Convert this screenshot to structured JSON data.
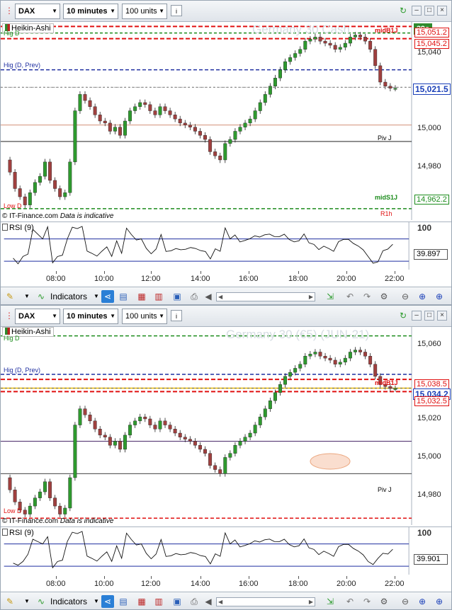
{
  "toolbar": {
    "instrument": "DAX",
    "interval": "10 minutes",
    "quantity": "100 units",
    "indicators_label": "Indicators"
  },
  "chart_top": {
    "watermark": "Germany 30 Cash",
    "indicator_tag": "Heikin-Ashi",
    "countdown": "39s",
    "copyright": "© IT-Finance.com",
    "copyright_note": "Data is indicative",
    "price_labels": [
      {
        "text": "15,051.2",
        "kind": "red"
      },
      {
        "text": "15,045.2",
        "kind": "red"
      },
      {
        "text": "15,040",
        "kind": "tick"
      },
      {
        "text": "15,021.5",
        "kind": "current"
      },
      {
        "text": "15,000",
        "kind": "tick"
      },
      {
        "text": "14,980",
        "kind": "tick"
      },
      {
        "text": "14,962.2",
        "kind": "green"
      }
    ],
    "level_labels": [
      "Hig D",
      "Hig (D, Prev)",
      "midB1J",
      "Piv J",
      "midS1J",
      "R1h",
      "Low D"
    ],
    "rsi_label": "RSI (9)",
    "rsi_value": "39.897",
    "rsi_scale": "100"
  },
  "chart_bottom": {
    "watermark": "Germany 30 (€5) (JUN-21)",
    "indicator_tag": "Heikin-Ashi",
    "copyright": "© IT-Finance.com",
    "copyright_note": "Data is indicative",
    "price_labels": [
      {
        "text": "15,060",
        "kind": "tick"
      },
      {
        "text": "15,038.5",
        "kind": "red"
      },
      {
        "text": "15,034.2",
        "kind": "current"
      },
      {
        "text": "15,032.5",
        "kind": "red"
      },
      {
        "text": "15,020",
        "kind": "tick"
      },
      {
        "text": "15,000",
        "kind": "tick"
      },
      {
        "text": "14,980",
        "kind": "tick"
      }
    ],
    "level_labels": [
      "Hig D",
      "Hig (D, Prev)",
      "midB1J",
      "Piv J",
      "Low D"
    ],
    "rsi_label": "RSI (9)",
    "rsi_value": "39.901",
    "rsi_scale": "100"
  },
  "time_axis": [
    "08:00",
    "10:00",
    "12:00",
    "14:00",
    "16:00",
    "18:00",
    "20:00",
    "22:00"
  ],
  "colors": {
    "bull": "#2e9a2e",
    "bear": "#a0403f",
    "current": "#1a3fb8",
    "level_red": "#e01010",
    "level_green": "#1c8c1c",
    "level_blue": "#1f2fa0"
  },
  "chart_data": [
    {
      "type": "candlestick",
      "title": "Germany 30 Cash",
      "x": "time",
      "ylim": [
        14958,
        15052
      ],
      "current": 15021.5,
      "levels": [
        15051.2,
        15048,
        15045.2,
        15030,
        15021.5,
        15003,
        14995,
        14962.2,
        14955
      ],
      "series": [
        {
          "name": "Heikin-Ashi",
          "values": [
            14986,
            14980,
            14972,
            14968,
            14964,
            14970,
            14975,
            14978,
            14985,
            14976,
            14972,
            14968,
            14970,
            14985,
            15010,
            15018,
            15015,
            15012,
            15008,
            15005,
            15004,
            15000,
            15002,
            14998,
            15005,
            15010,
            15012,
            15014,
            15013,
            15010,
            15008,
            15012,
            15010,
            15008,
            15006,
            15004,
            15003,
            15002,
            15000,
            14998,
            14996,
            14990,
            14988,
            14986,
            14994,
            14996,
            15000,
            15002,
            15004,
            15006,
            15010,
            15014,
            15018,
            15022,
            15026,
            15030,
            15034,
            15036,
            15038,
            15040,
            15044,
            15045,
            15046,
            15044,
            15043,
            15042,
            15040,
            15041,
            15043,
            15046,
            15047,
            15046,
            15044,
            15040,
            15032,
            15024,
            15022,
            15021,
            15021
          ]
        }
      ]
    },
    {
      "type": "candlestick",
      "title": "Germany 30 (€5) (JUN-21)",
      "x": "time",
      "ylim": [
        14968,
        15063
      ],
      "current": 15034.2,
      "levels": [
        15060,
        15041,
        15038.5,
        15034.2,
        15032.5,
        15008,
        14992,
        14970
      ],
      "series": [
        {
          "name": "Heikin-Ashi",
          "values": [
            14990,
            14984,
            14978,
            14974,
            14972,
            14976,
            14980,
            14983,
            14988,
            14980,
            14976,
            14972,
            14975,
            14990,
            15016,
            15024,
            15021,
            15018,
            15014,
            15011,
            15010,
            15006,
            15008,
            15004,
            15011,
            15016,
            15018,
            15020,
            15019,
            15016,
            15014,
            15018,
            15016,
            15014,
            15012,
            15010,
            15009,
            15008,
            15006,
            15004,
            15002,
            14996,
            14994,
            14992,
            15000,
            15002,
            15006,
            15008,
            15010,
            15012,
            15016,
            15020,
            15024,
            15028,
            15032,
            15036,
            15040,
            15042,
            15044,
            15046,
            15050,
            15051,
            15052,
            15050,
            15049,
            15048,
            15046,
            15047,
            15049,
            15052,
            15053,
            15052,
            15050,
            15046,
            15040,
            15036,
            15035,
            15034,
            15034
          ]
        }
      ]
    }
  ]
}
